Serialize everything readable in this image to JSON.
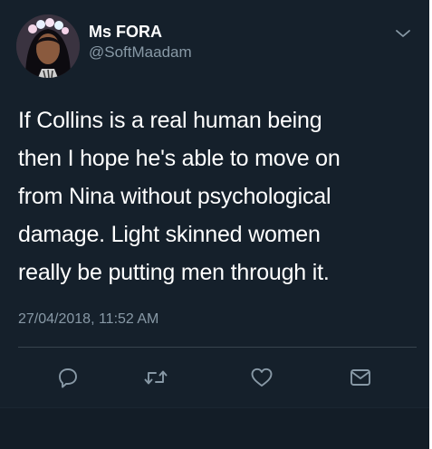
{
  "user": {
    "display_name": "Ms FORA",
    "handle": "@SoftMaadam"
  },
  "tweet": {
    "lines": [
      "If Collins is a real human being",
      "then I hope he's able to move on",
      "from Nina without psychological",
      "damage. Light skinned women",
      "really be putting men through it."
    ],
    "timestamp": "27/04/2018, 11:52 AM"
  },
  "actions": [
    {
      "name": "reply",
      "icon": "reply-icon"
    },
    {
      "name": "retweet",
      "icon": "retweet-icon"
    },
    {
      "name": "like",
      "icon": "heart-icon"
    },
    {
      "name": "message",
      "icon": "envelope-icon"
    }
  ],
  "colors": {
    "background": "#15202b",
    "text_primary": "#ffffff",
    "text_secondary": "#8899a6",
    "divider": "#38444d"
  }
}
